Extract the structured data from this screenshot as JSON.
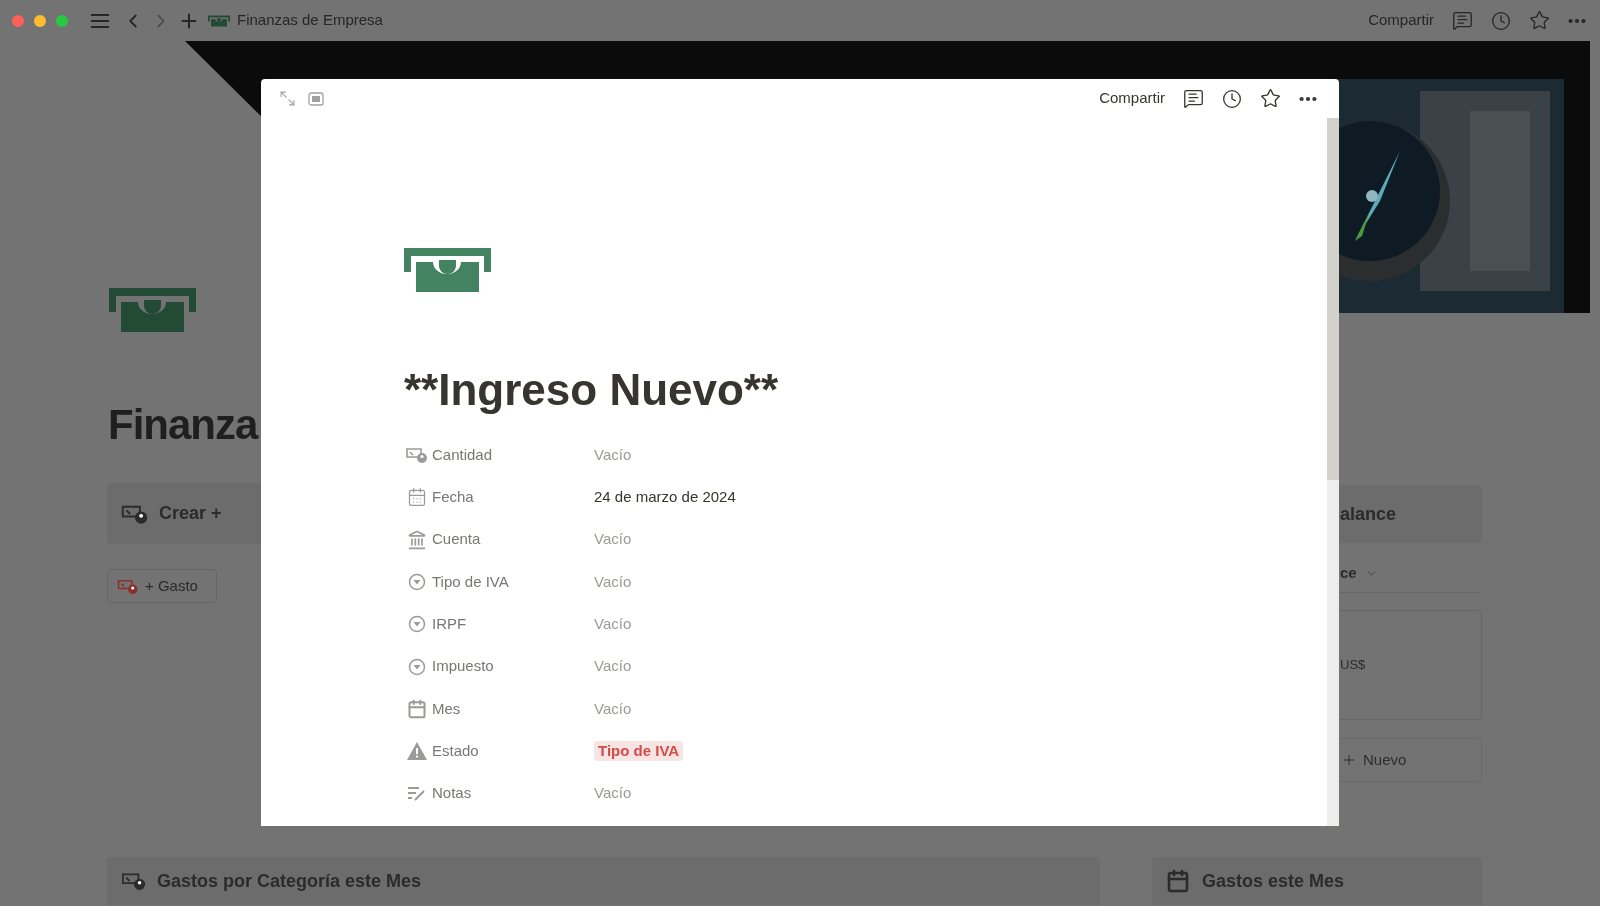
{
  "top_bar": {
    "breadcrumb": "Finanzas de Empresa",
    "share": "Compartir"
  },
  "background": {
    "title": "Finanza",
    "create_card": "Crear +",
    "expense_button": "+ Gasto",
    "balance_card": "alance",
    "view_tab": "ce",
    "amount": "US$",
    "new_button": "Nuevo",
    "sections": [
      "Gastos por Categoría este Mes",
      "Gastos este Mes"
    ]
  },
  "modal": {
    "share": "Compartir",
    "title": "**Ingreso Nuevo**",
    "properties": [
      {
        "kind": "number",
        "label": "Cantidad",
        "placeholder": "Vacío"
      },
      {
        "kind": "date",
        "label": "Fecha",
        "value": "24 de marzo de 2024"
      },
      {
        "kind": "relation",
        "label": "Cuenta",
        "placeholder": "Vacío"
      },
      {
        "kind": "select",
        "label": "Tipo de IVA",
        "placeholder": "Vacío"
      },
      {
        "kind": "select",
        "label": "IRPF",
        "placeholder": "Vacío"
      },
      {
        "kind": "select",
        "label": "Impuesto",
        "placeholder": "Vacío"
      },
      {
        "kind": "formula",
        "label": "Mes",
        "placeholder": "Vacío"
      },
      {
        "kind": "status",
        "label": "Estado",
        "value": "Tipo de IVA",
        "color": "#d44c47"
      },
      {
        "kind": "text",
        "label": "Notas",
        "placeholder": "Vacío"
      }
    ]
  }
}
